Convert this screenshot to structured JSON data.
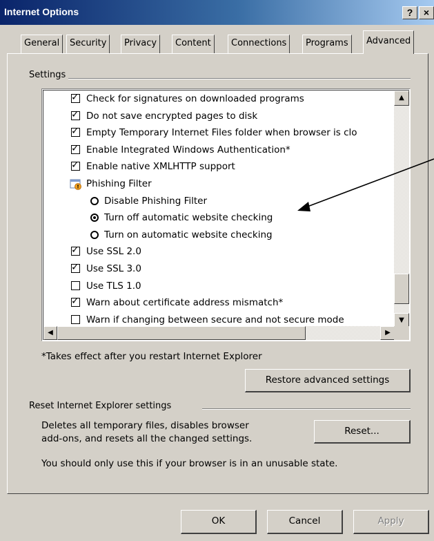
{
  "window": {
    "title": "Internet Options",
    "help_button": "?",
    "close_button": "×"
  },
  "tabs": [
    "General",
    "Security",
    "Privacy",
    "Content",
    "Connections",
    "Programs",
    "Advanced"
  ],
  "active_tab": "Advanced",
  "settings_group": {
    "label": "Settings",
    "items": [
      {
        "kind": "checkbox",
        "checked": true,
        "label": "Check for signatures on downloaded programs"
      },
      {
        "kind": "checkbox",
        "checked": true,
        "label": "Do not save encrypted pages to disk"
      },
      {
        "kind": "checkbox",
        "checked": true,
        "label": "Empty Temporary Internet Files folder when browser is clo"
      },
      {
        "kind": "checkbox",
        "checked": true,
        "label": "Enable Integrated Windows Authentication*"
      },
      {
        "kind": "checkbox",
        "checked": true,
        "label": "Enable native XMLHTTP support"
      },
      {
        "kind": "category",
        "label": "Phishing Filter"
      },
      {
        "kind": "radio",
        "checked": false,
        "label": "Disable Phishing Filter"
      },
      {
        "kind": "radio",
        "checked": true,
        "label": "Turn off automatic website checking"
      },
      {
        "kind": "radio",
        "checked": false,
        "label": "Turn on automatic website checking"
      },
      {
        "kind": "checkbox",
        "checked": true,
        "label": "Use SSL 2.0"
      },
      {
        "kind": "checkbox",
        "checked": true,
        "label": "Use SSL 3.0"
      },
      {
        "kind": "checkbox",
        "checked": false,
        "label": "Use TLS 1.0"
      },
      {
        "kind": "checkbox",
        "checked": true,
        "label": "Warn about certificate address mismatch*"
      },
      {
        "kind": "checkbox",
        "checked": false,
        "label": "Warn if changing between secure and not secure mode"
      }
    ],
    "footnote": "*Takes effect after you restart Internet Explorer",
    "restore_button": "Restore advanced settings"
  },
  "reset_group": {
    "label": "Reset Internet Explorer settings",
    "description_line1": "Deletes all temporary files, disables browser",
    "description_line2": "add-ons, and resets all the changed settings.",
    "warning": "You should only use this if your browser is in an unusable state.",
    "reset_button": "Reset..."
  },
  "footer": {
    "ok": "OK",
    "cancel": "Cancel",
    "apply": "Apply"
  },
  "icons": {
    "phishing": "phishing-filter-icon",
    "check": "✓",
    "scroll_up": "▲",
    "scroll_down": "▼",
    "scroll_left": "◀",
    "scroll_right": "▶"
  },
  "colors": {
    "titlebar": "#0a246a",
    "face": "#d4d0c8",
    "annotation": "#000000"
  }
}
